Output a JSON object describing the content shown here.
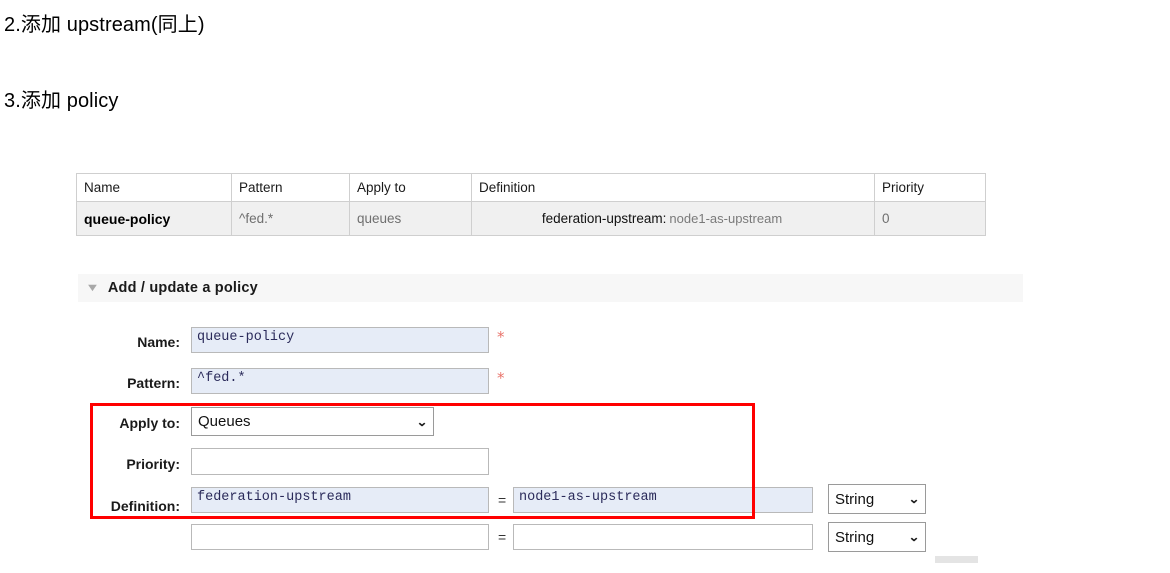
{
  "document": {
    "headings": [
      "2.添加 upstream(同上)",
      "3.添加 policy"
    ]
  },
  "policies_table": {
    "columns": [
      "Name",
      "Pattern",
      "Apply to",
      "Definition",
      "Priority"
    ],
    "rows": [
      {
        "name": "queue-policy",
        "pattern": "^fed.*",
        "apply_to": "queues",
        "definition_key": "federation-upstream:",
        "definition_value": "node1-as-upstream",
        "priority": "0"
      }
    ]
  },
  "form_section": {
    "caret": "▼",
    "title": "Add / update a policy",
    "fields": {
      "name_label": "Name:",
      "name_value": "queue-policy",
      "pattern_label": "Pattern:",
      "pattern_value": "^fed.*",
      "apply_to_label": "Apply to:",
      "apply_to_value": "Queues",
      "priority_label": "Priority:",
      "priority_value": "",
      "definition_label": "Definition:",
      "definition_rows": [
        {
          "key": "federation-upstream",
          "equals": "=",
          "value": "node1-as-upstream",
          "type": "String"
        },
        {
          "key": "",
          "equals": "=",
          "value": "",
          "type": "String"
        }
      ]
    },
    "required_marker": "*",
    "select_caret": "⌄"
  },
  "annotation": {
    "color": "#ff0000"
  }
}
